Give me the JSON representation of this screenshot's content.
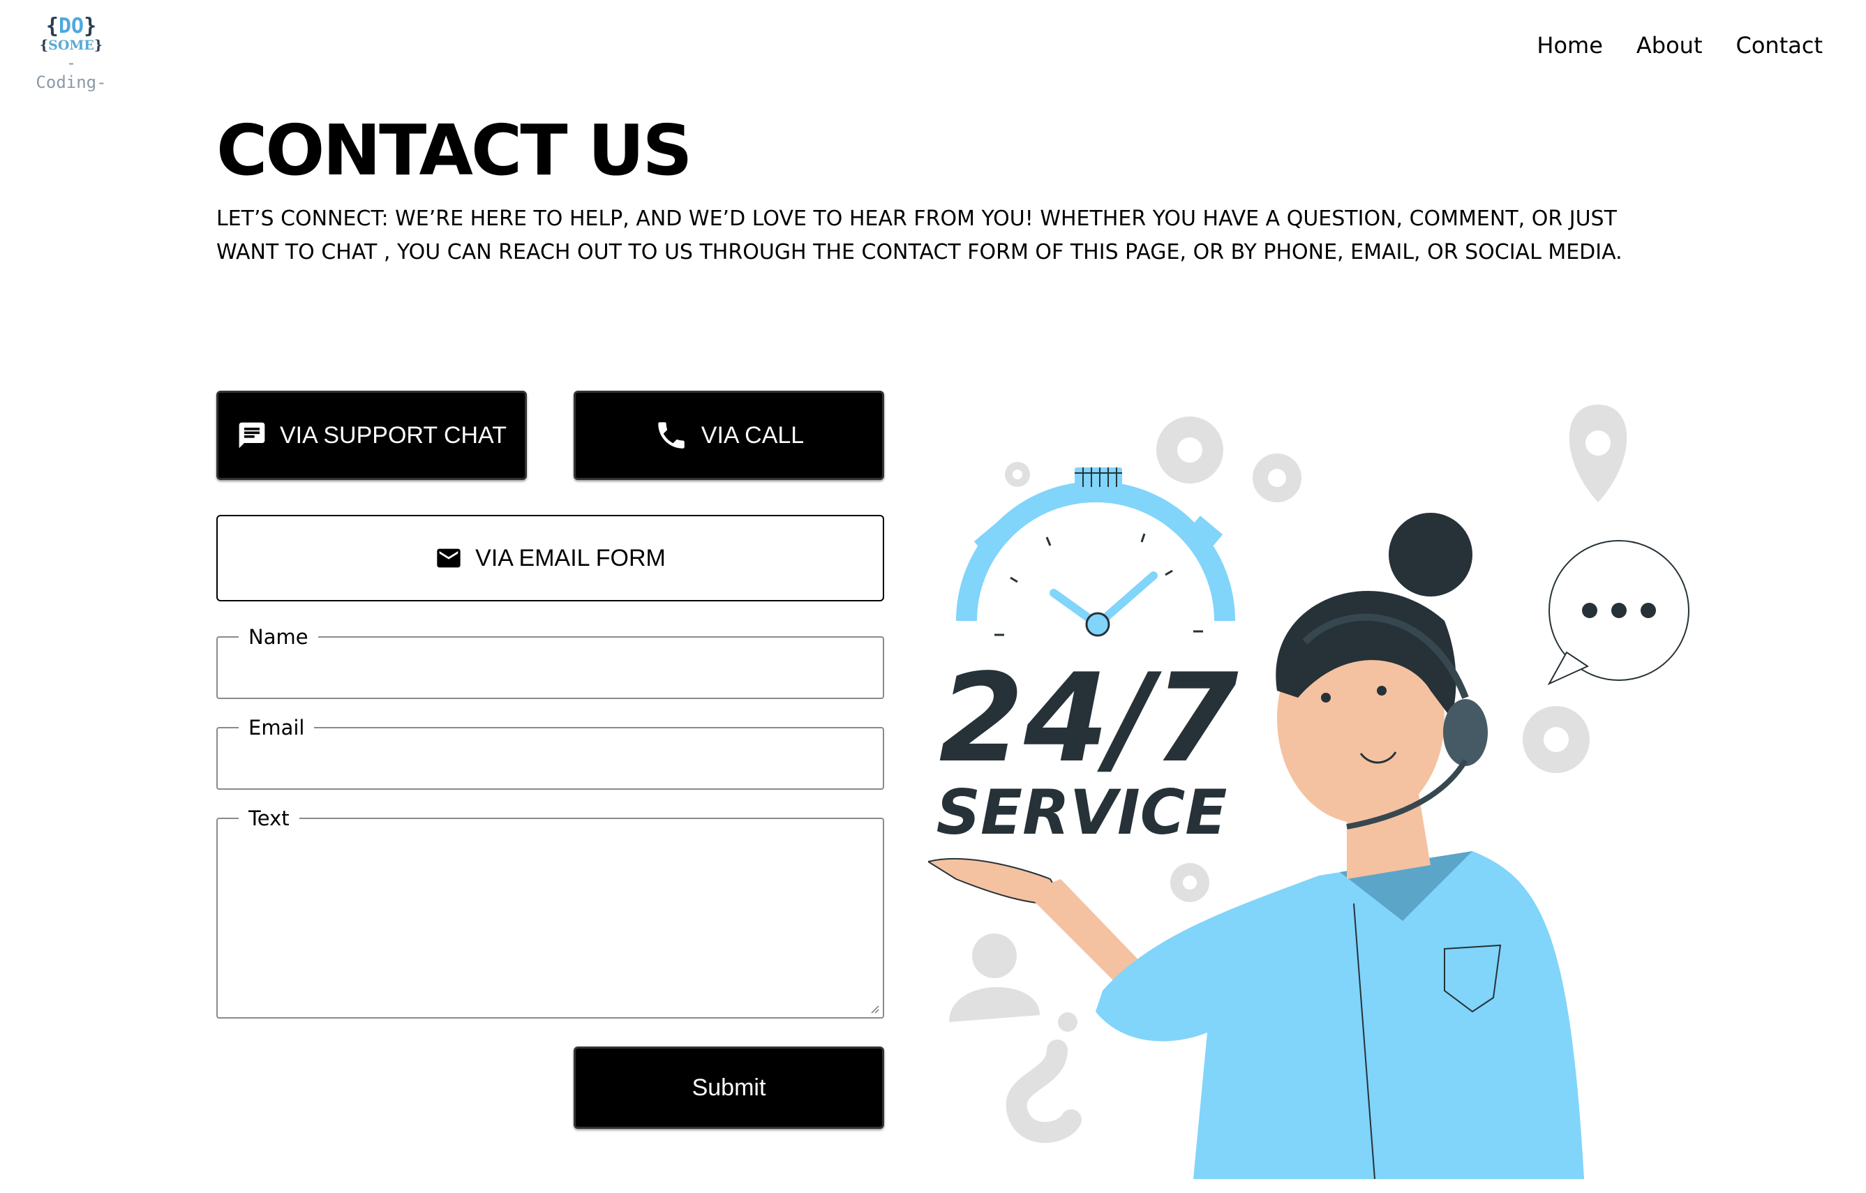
{
  "logo": {
    "line1_open": "{",
    "line1_text": "DO",
    "line1_close": "}",
    "line2_open": "{",
    "line2_text": "SOME",
    "line2_close": "}",
    "line3": "-Coding-"
  },
  "nav": {
    "items": [
      {
        "label": "Home"
      },
      {
        "label": "About"
      },
      {
        "label": "Contact"
      }
    ]
  },
  "page": {
    "title": "CONTACT US",
    "intro": "LET’S CONNECT: WE’RE HERE TO HELP, AND WE’D LOVE TO HEAR FROM YOU! WHETHER YOU HAVE A QUESTION, COMMENT, OR JUST WANT TO CHAT , YOU CAN REACH OUT TO US THROUGH THE CONTACT FORM OF THIS PAGE, OR BY PHONE, EMAIL, OR SOCIAL MEDIA."
  },
  "buttons": {
    "chat": {
      "label": "VIA SUPPORT CHAT",
      "icon": "chat-icon"
    },
    "call": {
      "label": "VIA CALL",
      "icon": "phone-icon"
    },
    "email": {
      "label": "VIA EMAIL FORM",
      "icon": "mail-icon"
    },
    "submit": {
      "label": "Submit"
    }
  },
  "form": {
    "name": {
      "legend": "Name",
      "value": ""
    },
    "email": {
      "legend": "Email",
      "value": ""
    },
    "text": {
      "legend": "Text",
      "value": ""
    }
  },
  "illustration": {
    "line1": "24/7",
    "line2": "SERVICE"
  },
  "colors": {
    "accent": "#81d4fa",
    "dark": "#263238",
    "skin": "#f4c2a1",
    "shirt": "#81d4fa"
  }
}
